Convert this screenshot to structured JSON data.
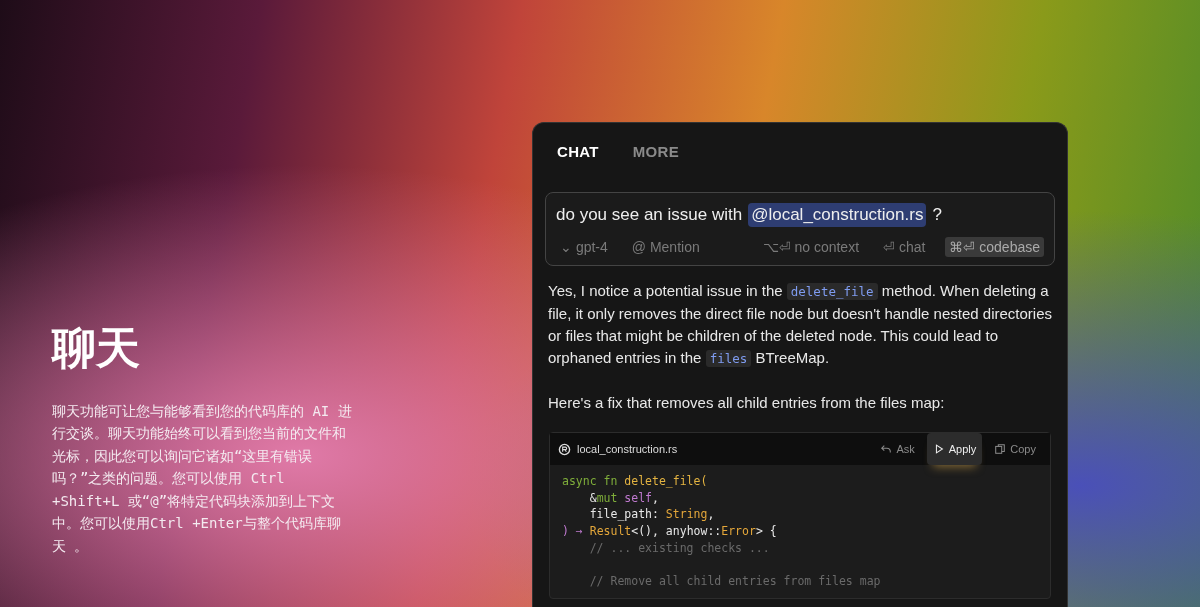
{
  "intro": {
    "title": "聊天",
    "body": "聊天功能可让您与能够看到您的代码库的 AI 进行交谈。聊天功能始终可以看到您当前的文件和光标，因此您可以询问它诸如“这里有错误吗？”之类的问题。您可以使用 Ctrl +Shift+L 或“@”将特定代码块添加到上下文中。您可以使用Ctrl +Enter与整个代码库聊天 。"
  },
  "tabs": [
    {
      "label": "CHAT",
      "selected": true
    },
    {
      "label": "MORE",
      "selected": false
    }
  ],
  "prompt": {
    "text": "do you see an issue with",
    "mention": "@local_construction.rs",
    "after": "?"
  },
  "prompt_options": [
    {
      "kind": "model",
      "label": "gpt-4",
      "icon": "⌄",
      "highlighted": false
    },
    {
      "kind": "mention",
      "label": "Mention",
      "icon": "@",
      "highlighted": false
    },
    {
      "kind": "shortcut",
      "label": "no context",
      "icon": "⌥⏎",
      "highlighted": false
    },
    {
      "kind": "shortcut",
      "label": "chat",
      "icon": "⏎",
      "highlighted": false
    },
    {
      "kind": "shortcut",
      "label": "codebase",
      "icon": "⌘⏎",
      "highlighted": true
    }
  ],
  "answer": [
    [
      {
        "kind": "text",
        "text": "Yes, I notice a potential issue in the "
      },
      {
        "kind": "code",
        "text": "delete_file"
      },
      {
        "kind": "text",
        "text": " method. When deleting a file, it only removes the direct file node but doesn't handle nested directories or files that might be children of the deleted node. This could lead to orphaned entries in the "
      },
      {
        "kind": "code",
        "text": "files"
      },
      {
        "kind": "text",
        "text": " BTreeMap."
      }
    ],
    [
      {
        "kind": "text",
        "text": "Here's a fix that removes all child entries from the files map:"
      }
    ]
  ],
  "code_block": {
    "filename": "local_construction.rs",
    "actions": [
      {
        "label": "Ask",
        "highlighted": false
      },
      {
        "label": "Apply",
        "highlighted": true
      },
      {
        "label": "Copy",
        "highlighted": false
      }
    ],
    "lines": [
      {
        "kind": "code",
        "tokens": [
          {
            "kind": "keyword",
            "text": "async fn "
          },
          {
            "kind": "function",
            "text": "delete_file("
          }
        ]
      },
      {
        "kind": "code",
        "tokens": [
          {
            "kind": "plain",
            "text": "    &"
          },
          {
            "kind": "keyword",
            "text": "mut "
          },
          {
            "kind": "self",
            "text": "self"
          },
          {
            "kind": "plain",
            "text": ","
          }
        ]
      },
      {
        "kind": "code",
        "tokens": [
          {
            "kind": "plain",
            "text": "    file_path: "
          },
          {
            "kind": "type",
            "text": "String"
          },
          {
            "kind": "plain",
            "text": ","
          }
        ]
      },
      {
        "kind": "code",
        "tokens": [
          {
            "kind": "self",
            "text": ") → "
          },
          {
            "kind": "type",
            "text": "Result"
          },
          {
            "kind": "plain",
            "text": "<(), anyhow::"
          },
          {
            "kind": "type",
            "text": "Error"
          },
          {
            "kind": "plain",
            "text": "> {"
          }
        ]
      },
      {
        "kind": "code",
        "tokens": [
          {
            "kind": "comment",
            "text": "    // ... existing checks ..."
          }
        ]
      },
      {
        "kind": "blank"
      },
      {
        "kind": "code",
        "tokens": [
          {
            "kind": "comment",
            "text": "    // Remove all child entries from files map"
          }
        ]
      }
    ]
  }
}
